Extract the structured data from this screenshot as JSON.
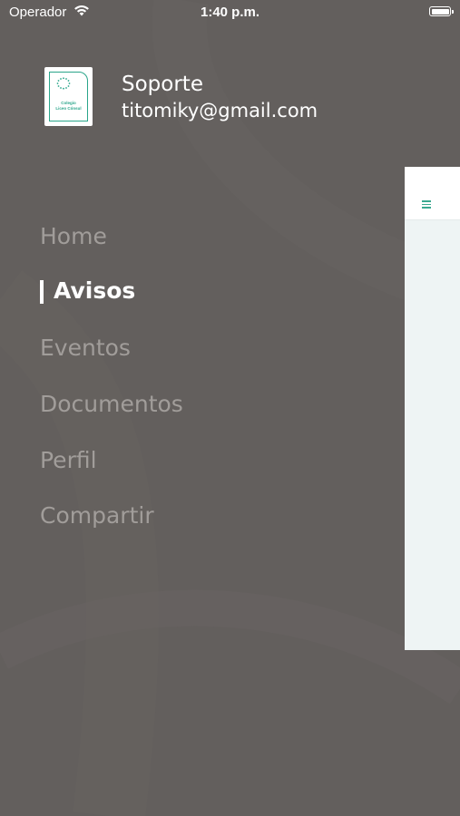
{
  "status_bar": {
    "carrier": "Operador",
    "time": "1:40 p.m."
  },
  "profile": {
    "logo_text_line1": "Colegio",
    "logo_text_line2": "Liceo Cónsul",
    "name": "Soporte",
    "email": "titomiky@gmail.com"
  },
  "menu": {
    "items": [
      {
        "label": "Home",
        "active": false
      },
      {
        "label": "Avisos",
        "active": true
      },
      {
        "label": "Eventos",
        "active": false
      },
      {
        "label": "Documentos",
        "active": false
      },
      {
        "label": "Perfil",
        "active": false
      },
      {
        "label": "Compartir",
        "active": false
      }
    ]
  },
  "colors": {
    "background": "#635f5d",
    "inactive_text": "#a19d9a",
    "active_text": "#ffffff",
    "accent": "#2aa58a"
  },
  "icons": [
    "wifi-icon",
    "battery-icon",
    "hamburger-menu-icon",
    "school-logo"
  ]
}
